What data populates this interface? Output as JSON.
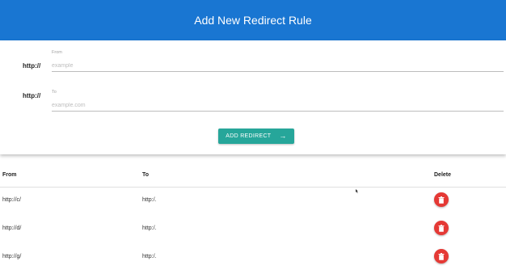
{
  "header": {
    "title": "Add New Redirect Rule"
  },
  "form": {
    "from": {
      "prefix": "http://",
      "label": "From",
      "placeholder": "example",
      "value": ""
    },
    "to": {
      "prefix": "http://",
      "label": "To",
      "placeholder": "example.com",
      "value": ""
    },
    "submit_label": "ADD REDIRECT",
    "submit_icon": "arrow-right-icon"
  },
  "table": {
    "columns": {
      "from": "From",
      "to": "To",
      "delete": "Delete"
    },
    "rows": [
      {
        "from": "http://c/",
        "to": "http:/."
      },
      {
        "from": "http://d/",
        "to": "http:/."
      },
      {
        "from": "http://g/",
        "to": "http:/."
      }
    ],
    "delete_icon": "trash-icon"
  },
  "colors": {
    "header_bg": "#1976d2",
    "button_bg": "#26a69a",
    "delete_bg": "#e53935"
  }
}
